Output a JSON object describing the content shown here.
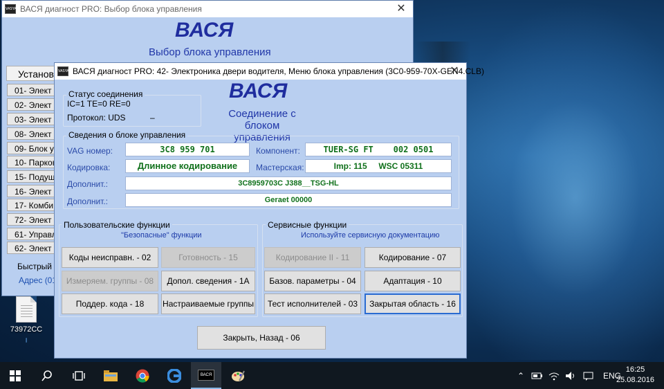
{
  "back_window": {
    "title": "ВАСЯ диагност PRO:  Выбор блока управления",
    "brand": "ВАСЯ",
    "subtitle": "Выбор блока управления",
    "list_header": "Установ",
    "items": [
      "01- Элект",
      "02- Элект",
      "03- Элект",
      "08- Элект",
      "09- Блок у",
      "10- Парков",
      "15- Подуш",
      "16- Элект",
      "17- Комби",
      "72- Элект",
      "61- Управл",
      "62- Элект"
    ],
    "bottom_label": "Быстрый в",
    "bottom_link": "Адрес (01"
  },
  "front_window": {
    "title": "ВАСЯ диагност PRO: 42- Электроника двери водителя,  Меню блока управления (3C0-959-70X-GEN4.CLB)",
    "brand": "ВАСЯ",
    "subtitle_line1": "Соединение с блоком",
    "subtitle_line2": "управления",
    "connection": {
      "group_title": "Статус соединения",
      "line1": "IC=1  TE=0   RE=0",
      "protocol": "Протокол: UDS",
      "dash": "–"
    },
    "info": {
      "group_title": "Сведения о блоке управления",
      "vag_label": "VAG номер:",
      "vag_value": "3C8 959 701",
      "component_label": "Компонент:",
      "component_value": "TUER-SG FT    002 0501",
      "coding_label": "Кодировка:",
      "coding_value": "Длинное кодирование",
      "workshop_label": "Мастерская:",
      "workshop_value": "Imp: 115     WSC 05311",
      "extra1_label": "Дополнит.:",
      "extra1_value": "3C8959703C J388__TSG-HL",
      "extra2_label": "Дополнит.:",
      "extra2_value": "Geraet 00000"
    },
    "user_functions": {
      "group_title": "Пользовательские функции",
      "hint": "\"Безопасные\" функции",
      "buttons": [
        "Коды неисправн. - 02",
        "Готовность - 15",
        "Измеряем. группы - 08",
        "Допол. сведения - 1А",
        "Поддер. кода - 18",
        "Настраиваемые группы"
      ]
    },
    "service_functions": {
      "group_title": "Сервисные функции",
      "hint": "Используйте сервисную документацию",
      "buttons": [
        "Кодирование II - 11",
        "Кодирование - 07",
        "Базов. параметры - 04",
        "Адаптация - 10",
        "Тест исполнителей - 03",
        "Закрытая область - 16"
      ]
    },
    "close_button": "Закрыть, Назад - 06"
  },
  "desktop": {
    "icon_label": "73972CC",
    "icon_sub": "╷"
  },
  "taskbar": {
    "lang": "ENG",
    "time": "16:25",
    "date": "25.08.2016",
    "app_label": "ВАСЯ"
  },
  "colors": {
    "window_bg": "#b9cff0",
    "brand": "#1f2d9e",
    "field_text": "#11711c",
    "taskbar": "#101820"
  }
}
